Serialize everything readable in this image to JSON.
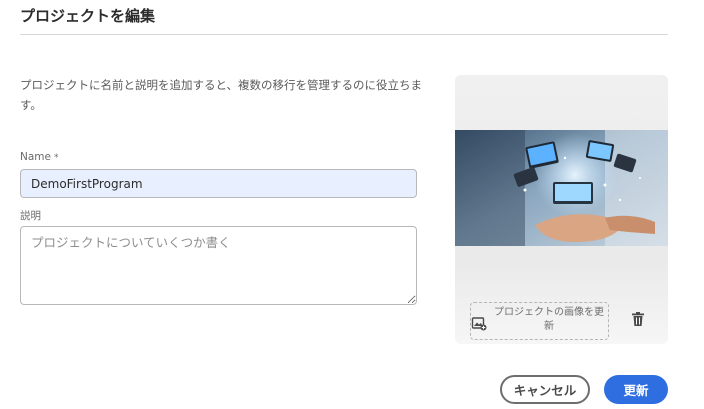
{
  "dialog": {
    "title": "プロジェクトを編集",
    "description": "プロジェクトに名前と説明を追加すると、複数の移行を管理するのに役立ちます。"
  },
  "form": {
    "name_label": "Name",
    "required_marker": "*",
    "name_value": "DemoFirstProgram",
    "description_label": "説明",
    "description_placeholder": "プロジェクトについていくつか書く",
    "description_value": ""
  },
  "image_panel": {
    "change_image_label": "プロジェクトの画像を更新",
    "change_image_icon": "image-add-icon",
    "delete_icon": "trash-icon"
  },
  "footer": {
    "cancel_label": "キャンセル",
    "update_label": "更新"
  },
  "colors": {
    "primary": "#2f6ee0",
    "input_fill": "#e8efff"
  }
}
